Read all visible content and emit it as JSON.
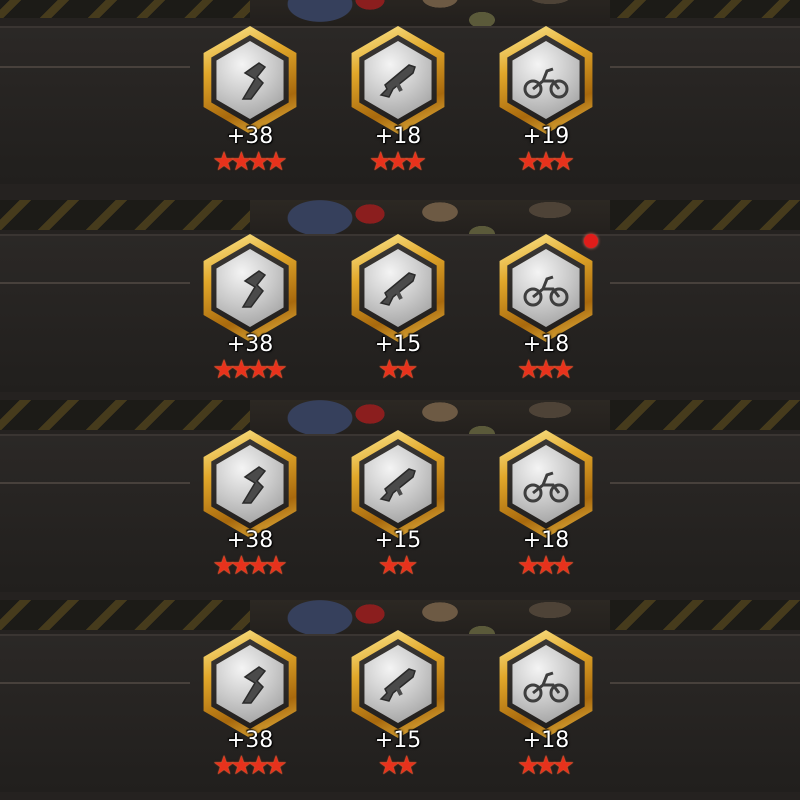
{
  "panels": [
    {
      "badges": [
        {
          "icon": "blade-icon",
          "level": "+38",
          "stars": 4
        },
        {
          "icon": "rifle-icon",
          "level": "+18",
          "stars": 3
        },
        {
          "icon": "motorcycle-icon",
          "level": "+19",
          "stars": 3
        }
      ],
      "notification": false
    },
    {
      "badges": [
        {
          "icon": "blade-icon",
          "level": "+38",
          "stars": 4
        },
        {
          "icon": "rifle-icon",
          "level": "+15",
          "stars": 2
        },
        {
          "icon": "motorcycle-icon",
          "level": "+18",
          "stars": 3
        }
      ],
      "notification": true
    },
    {
      "badges": [
        {
          "icon": "blade-icon",
          "level": "+38",
          "stars": 4
        },
        {
          "icon": "rifle-icon",
          "level": "+15",
          "stars": 2
        },
        {
          "icon": "motorcycle-icon",
          "level": "+18",
          "stars": 3
        }
      ],
      "notification": false
    },
    {
      "badges": [
        {
          "icon": "blade-icon",
          "level": "+38",
          "stars": 4
        },
        {
          "icon": "rifle-icon",
          "level": "+15",
          "stars": 2
        },
        {
          "icon": "motorcycle-icon",
          "level": "+18",
          "stars": 3
        }
      ],
      "notification": false
    }
  ],
  "colors": {
    "star": "#e8321c",
    "badge_gold": "#e1a72a",
    "notification": "#e01d1a"
  }
}
